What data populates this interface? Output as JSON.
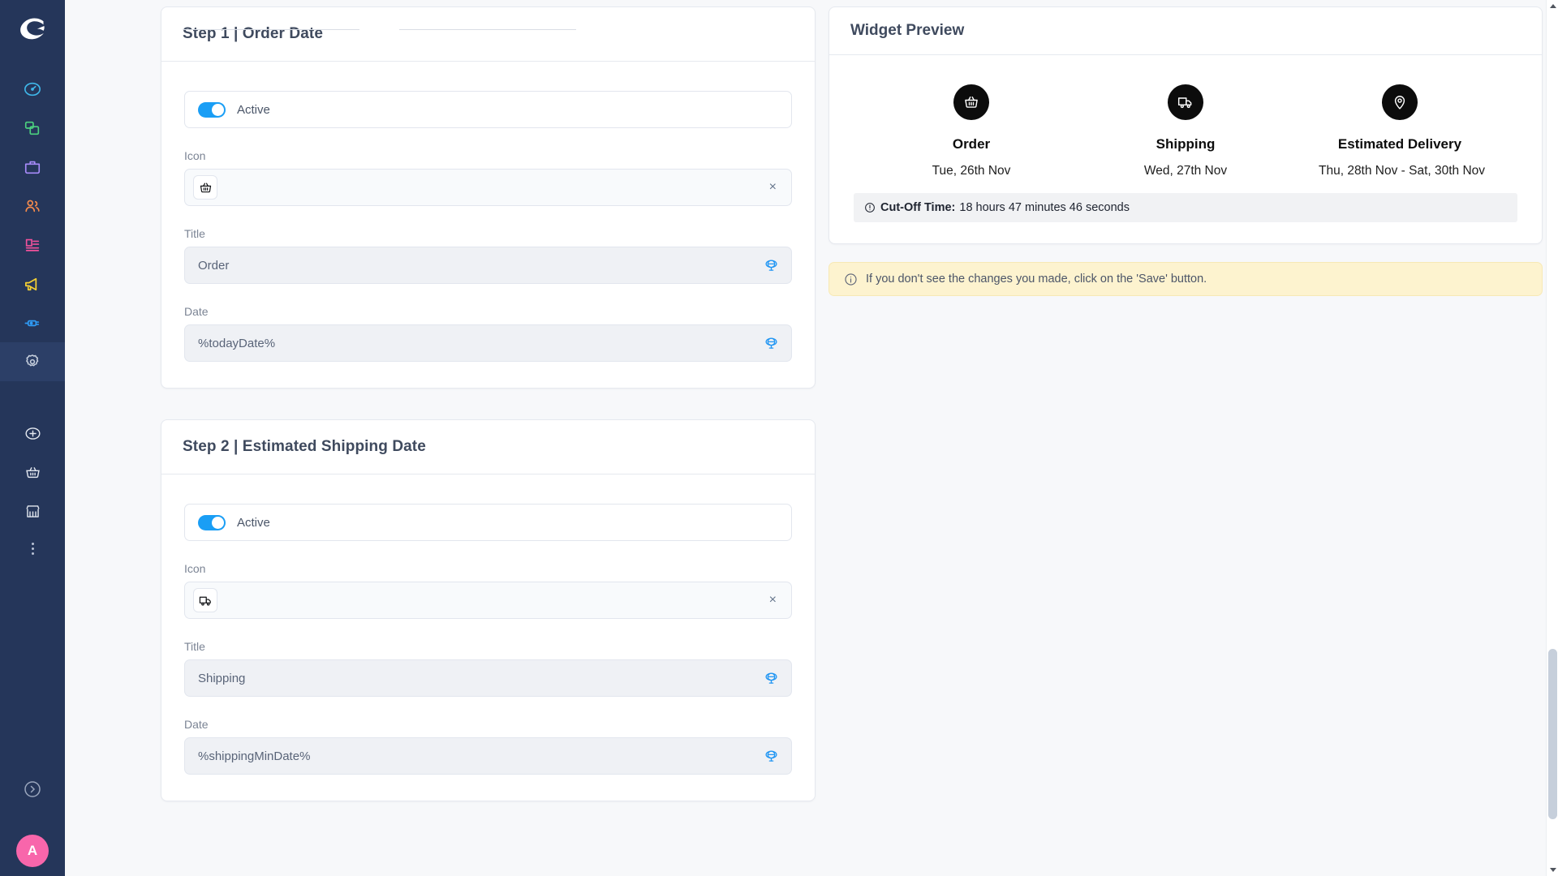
{
  "app": {
    "logo_name": "brand-logo",
    "accent_blue": "#1a9ef5",
    "sidebar_bg": "#25365a",
    "page_bg": "#f7f8fa",
    "avatar_bg": "#f866ab",
    "avatar_initial": "A"
  },
  "sidebar": {
    "items": [
      {
        "name": "dashboard",
        "icon": "gauge-icon",
        "color": "#3fb6e8"
      },
      {
        "name": "campaigns",
        "icon": "copy-windows-icon",
        "color": "#4cd17f"
      },
      {
        "name": "briefcase",
        "icon": "briefcase-icon",
        "color": "#a78bfa"
      },
      {
        "name": "audience",
        "icon": "users-icon",
        "color": "#f58b4c"
      },
      {
        "name": "forms",
        "icon": "form-list-icon",
        "color": "#f0519b"
      },
      {
        "name": "announcements",
        "icon": "megaphone-icon",
        "color": "#f5d033"
      },
      {
        "name": "integrations",
        "icon": "plug-icon",
        "color": "#2f9bf5"
      },
      {
        "name": "settings",
        "icon": "gear-icon",
        "color": "#c6cfdd",
        "active": true
      }
    ],
    "lower_items": [
      {
        "name": "add",
        "icon": "plus-circle-icon",
        "color": "#e3e8f0"
      },
      {
        "name": "basket",
        "icon": "basket-icon",
        "color": "#e3e8f0"
      },
      {
        "name": "store",
        "icon": "store-icon",
        "color": "#e3e8f0"
      },
      {
        "name": "more",
        "icon": "more-vertical-icon",
        "color": "#b9c3d6"
      }
    ],
    "collapse": {
      "name": "collapse-toggle",
      "icon": "chevron-right-circle-icon"
    }
  },
  "steps": [
    {
      "card_title": "Step 1 | Order Date",
      "toggle_label": "Active",
      "toggle_on": true,
      "icon_label": "Icon",
      "icon_glyph": "basket-icon",
      "clear_label": "×",
      "title_label": "Title",
      "title_value": "Order",
      "date_label": "Date",
      "date_value": "%todayDate%"
    },
    {
      "card_title": "Step 2 | Estimated Shipping Date",
      "toggle_label": "Active",
      "toggle_on": true,
      "icon_label": "Icon",
      "icon_glyph": "truck-icon",
      "clear_label": "×",
      "title_label": "Title",
      "title_value": "Shipping",
      "date_label": "Date",
      "date_value": "%shippingMinDate%"
    }
  ],
  "preview": {
    "title": "Widget Preview",
    "steps": [
      {
        "icon": "basket-icon",
        "name": "Order",
        "date": "Tue, 26th Nov"
      },
      {
        "icon": "truck-icon",
        "name": "Shipping",
        "date": "Wed, 27th Nov"
      },
      {
        "icon": "map-pin-icon",
        "name": "Estimated Delivery",
        "date": "Thu, 28th Nov - Sat, 30th Nov"
      }
    ],
    "cutoff_label": "Cut-Off Time:",
    "cutoff_value": "18 hours 47 minutes 46 seconds",
    "notice": "If you don't see the changes you made, click on the 'Save' button."
  }
}
